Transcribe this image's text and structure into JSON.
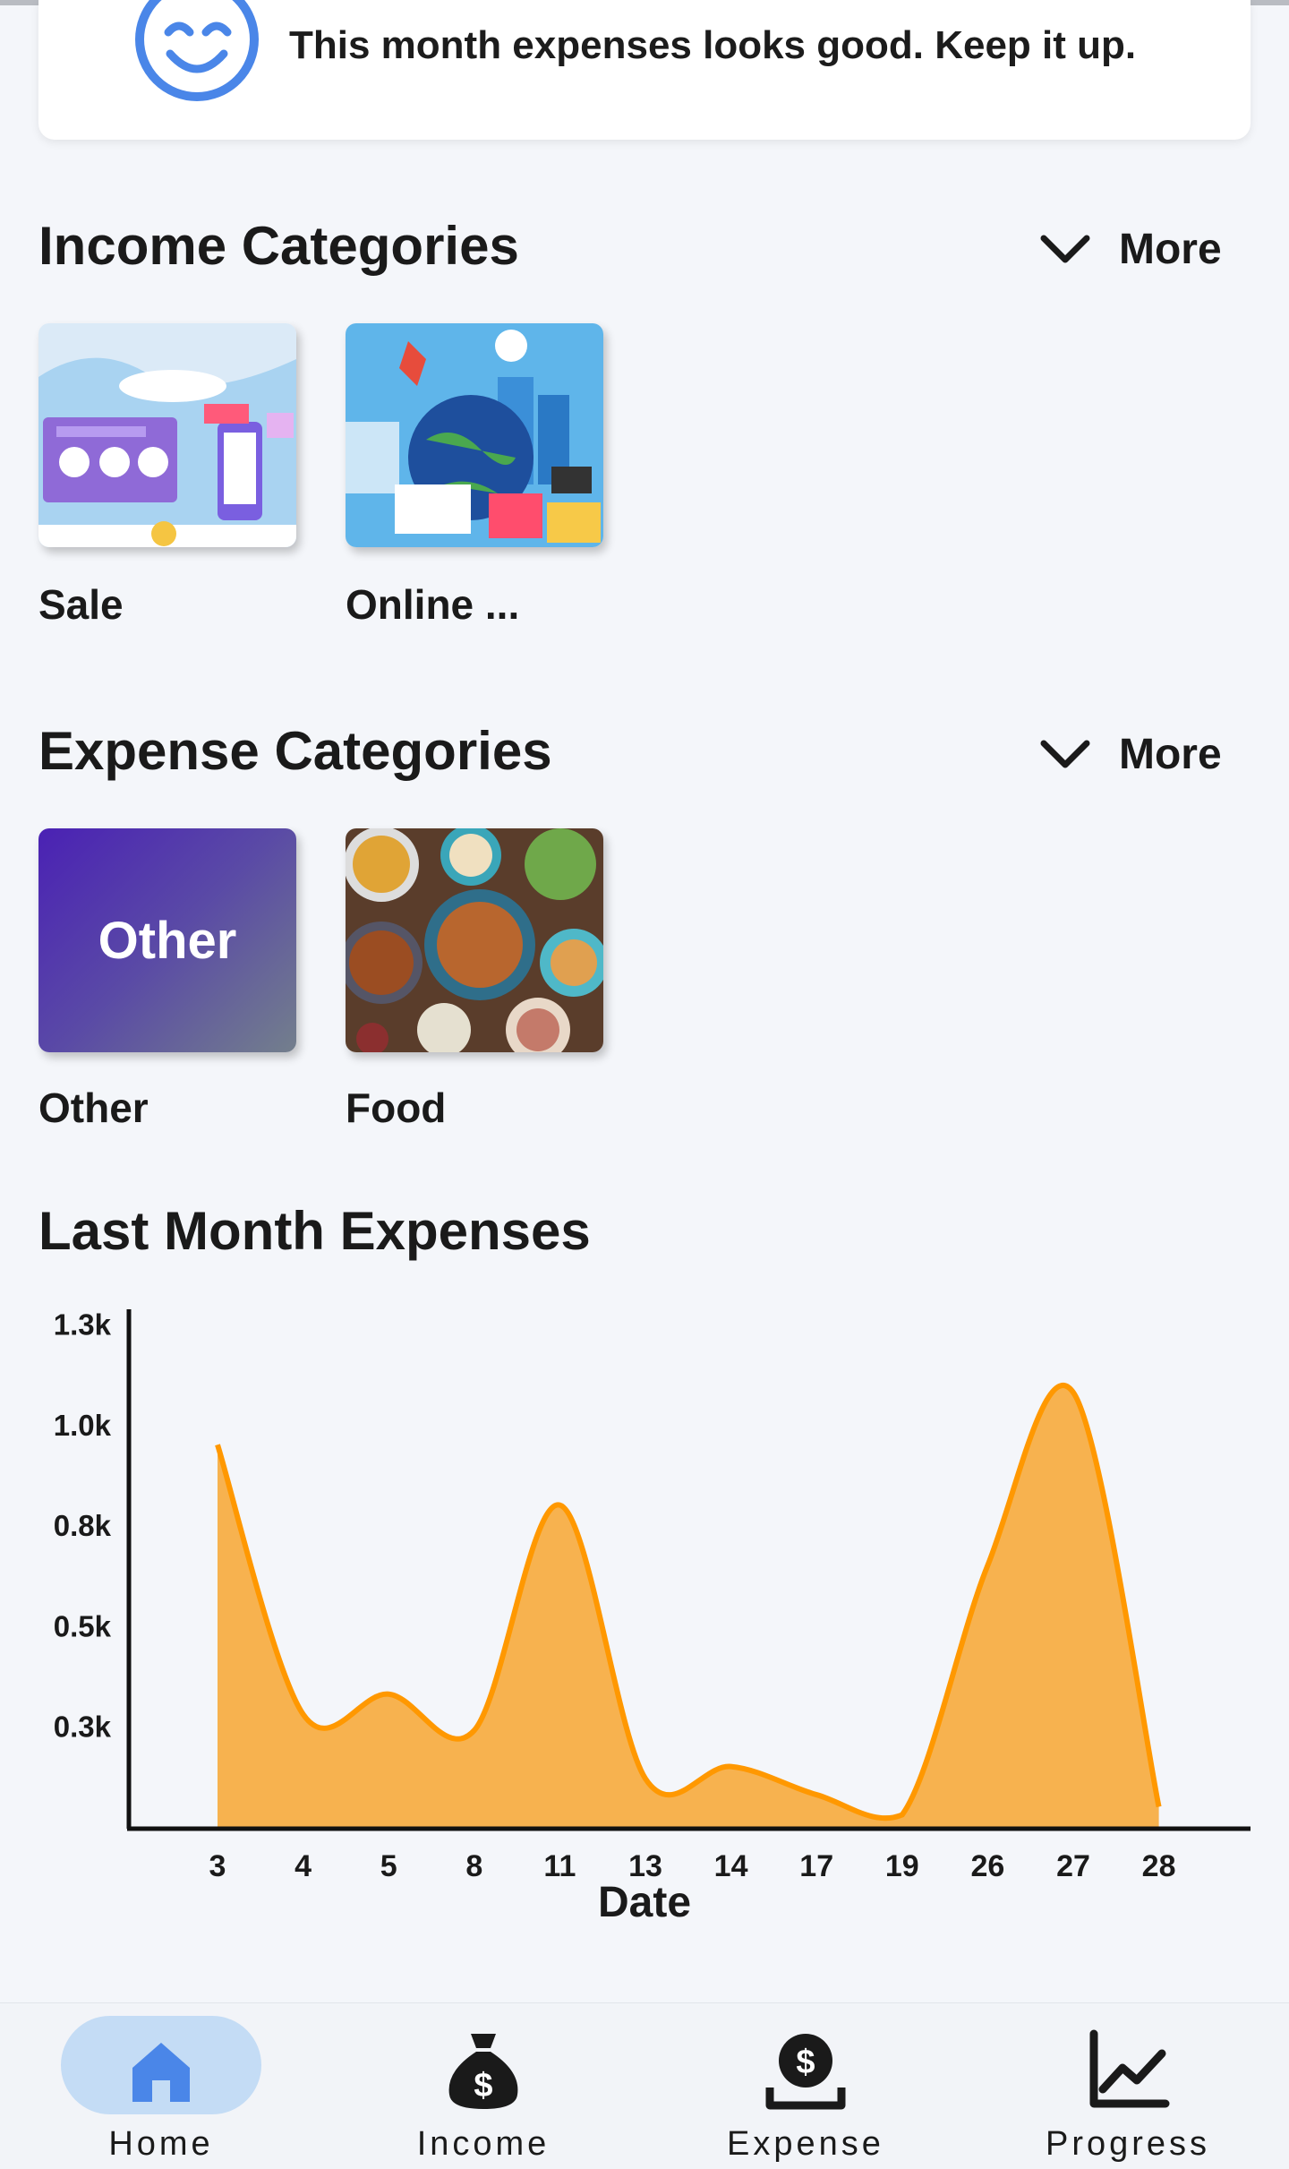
{
  "status_message": "This month expenses looks good. Keep it up.",
  "income_section": {
    "title": "Income Categories",
    "more_label": "More",
    "items": [
      {
        "label": "Sale"
      },
      {
        "label": "Online ..."
      }
    ]
  },
  "expense_section": {
    "title": "Expense Categories",
    "more_label": "More",
    "items": [
      {
        "label": "Other",
        "tile_text": "Other"
      },
      {
        "label": "Food"
      }
    ]
  },
  "chart_section": {
    "title": "Last Month Expenses"
  },
  "chart_data": {
    "type": "area",
    "title": "Last Month Expenses",
    "xlabel": "Date",
    "ylabel": "",
    "categories": [
      "3",
      "4",
      "5",
      "8",
      "11",
      "13",
      "14",
      "17",
      "19",
      "26",
      "27",
      "28"
    ],
    "values": [
      950,
      280,
      330,
      240,
      800,
      120,
      150,
      80,
      30,
      650,
      1080,
      50
    ],
    "y_ticks": [
      "0.3k",
      "0.5k",
      "0.8k",
      "1.0k",
      "1.3k"
    ],
    "y_tick_values": [
      250,
      500,
      750,
      1000,
      1250
    ],
    "ylim": [
      0,
      1280
    ],
    "grid": false,
    "fill_color": "#f7b24f",
    "line_color": "#ff9800"
  },
  "bottom_nav": {
    "items": [
      {
        "label": "Home",
        "icon": "home-icon",
        "active": true
      },
      {
        "label": "Income",
        "icon": "money-bag-icon",
        "active": false
      },
      {
        "label": "Expense",
        "icon": "expense-icon",
        "active": false
      },
      {
        "label": "Progress",
        "icon": "progress-chart-icon",
        "active": false
      }
    ]
  },
  "colors": {
    "background": "#f4f6fa",
    "accent_blue": "#4a86e8",
    "nav_active_pill": "#c4dcf5"
  }
}
